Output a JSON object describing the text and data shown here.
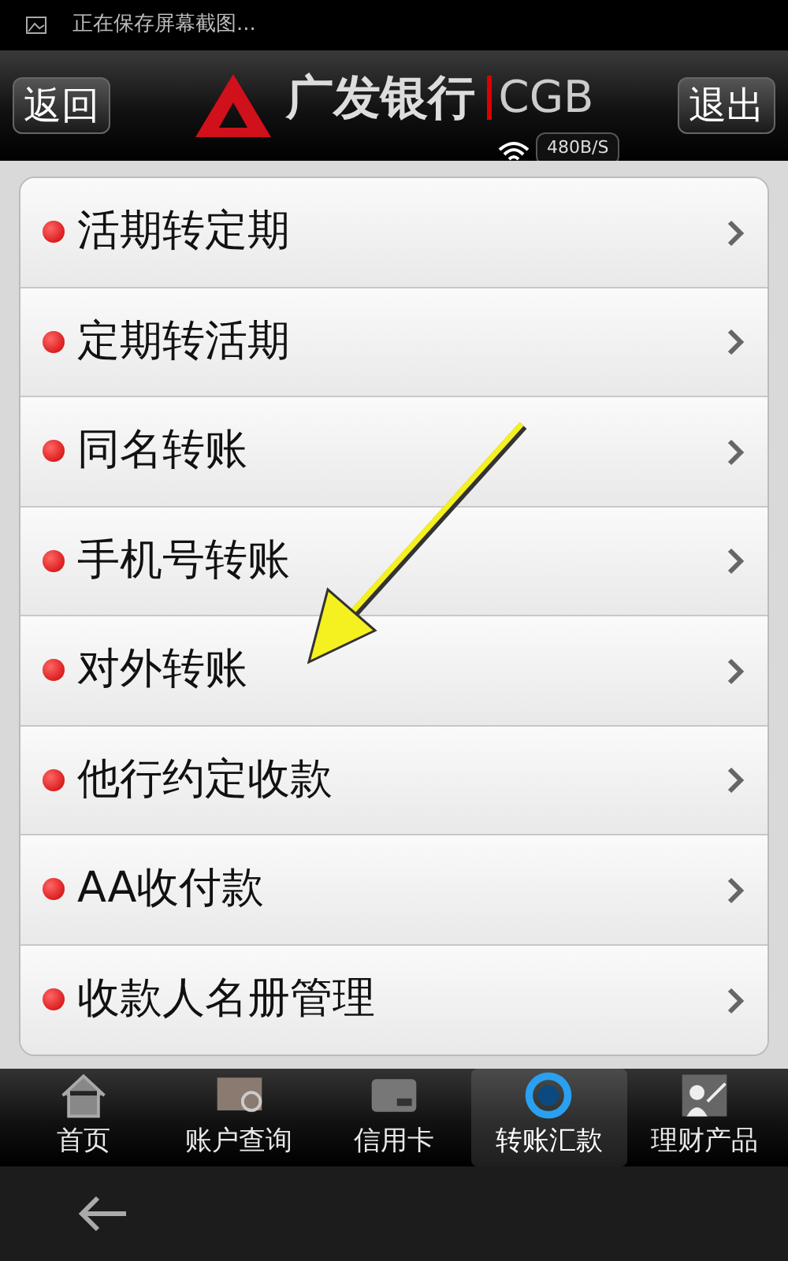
{
  "status_bar": {
    "notification": "正在保存屏幕截图..."
  },
  "header": {
    "back_button": "返回",
    "logo_text": "广发银行",
    "logo_latin": "CGB",
    "exit_button": "退出",
    "speed": "480B/S"
  },
  "menu": [
    {
      "label": "活期转定期"
    },
    {
      "label": "定期转活期"
    },
    {
      "label": "同名转账"
    },
    {
      "label": "手机号转账"
    },
    {
      "label": "对外转账"
    },
    {
      "label": "他行约定收款"
    },
    {
      "label": "AA收付款"
    },
    {
      "label": "收款人名册管理"
    }
  ],
  "tabs": [
    {
      "label": "首页",
      "kind": "home",
      "selected": false
    },
    {
      "label": "账户查询",
      "kind": "query",
      "selected": false
    },
    {
      "label": "信用卡",
      "kind": "card",
      "selected": false
    },
    {
      "label": "转账汇款",
      "kind": "transfer",
      "selected": true
    },
    {
      "label": "理财产品",
      "kind": "finance",
      "selected": false
    }
  ],
  "annotation": {
    "kind": "arrow"
  }
}
